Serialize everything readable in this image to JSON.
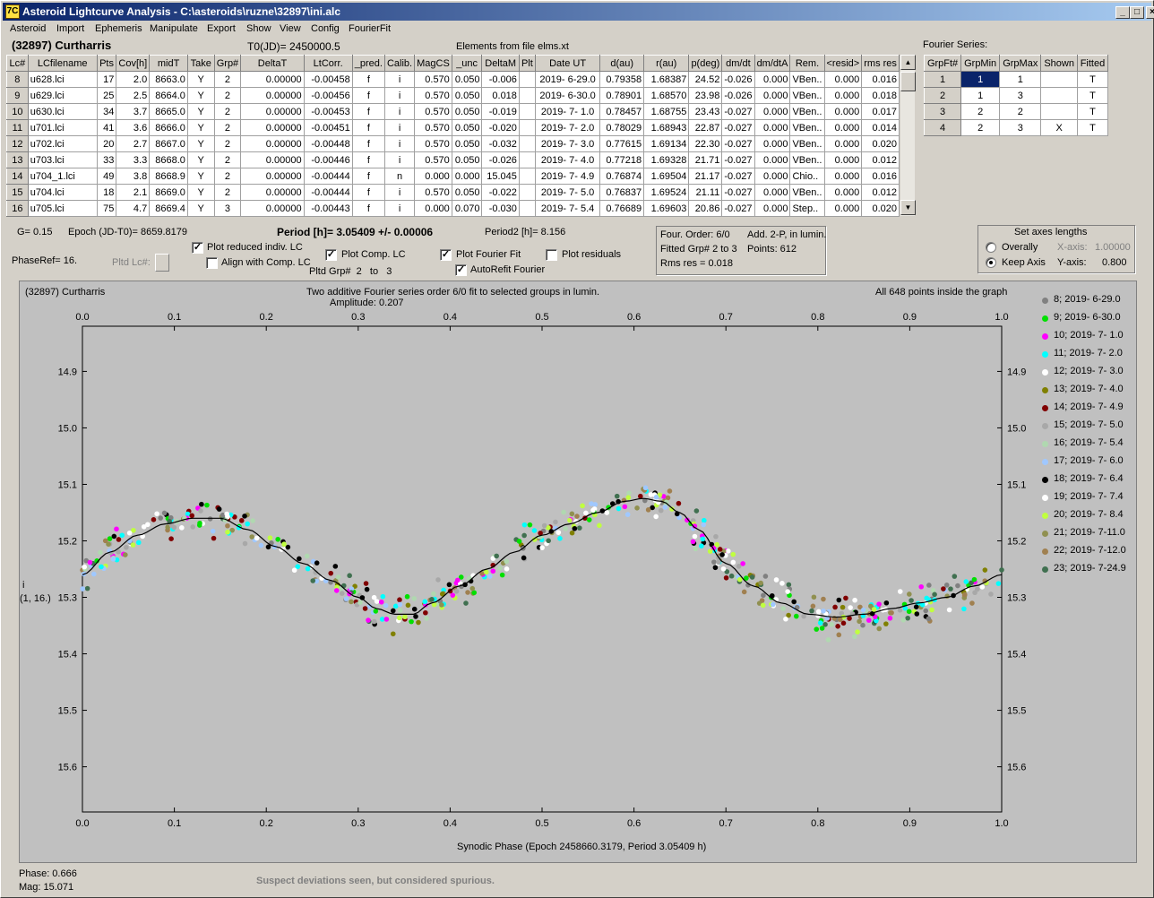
{
  "window": {
    "title": "Asteroid Lightcurve Analysis - C:\\asteroids\\ruzne\\32897\\ini.alc",
    "icon": "7C",
    "min": "_",
    "max": "□",
    "close": "×"
  },
  "menu": [
    "Asteroid",
    "Import",
    "Ephemeris",
    "Manipulate",
    "Export",
    "Show",
    "View",
    "Config",
    "FourierFit"
  ],
  "header": {
    "asteroid": "(32897) Curtharris",
    "t0": "T0(JD)= 2450000.5",
    "elements": "Elements from file elms.xt"
  },
  "table": {
    "columns": [
      "Lc#",
      "LCfilename",
      "Pts",
      "Cov[h]",
      "midT",
      "Take",
      "Grp#",
      "DeltaT",
      "LtCorr.",
      "_pred.",
      "Calib.",
      "MagCS",
      "_unc",
      "DeltaM",
      "Plt",
      "Date UT",
      "d(au)",
      "r(au)",
      "p(deg)",
      "dm/dt",
      "dm/dtA",
      "Rem.",
      "<resid>",
      "rms res"
    ],
    "rows": [
      [
        "8",
        "u628.lci",
        "17",
        "2.0",
        "8663.0",
        "Y",
        "2",
        "0.00000",
        "-0.00458",
        "f",
        "i",
        "0.570",
        "0.050",
        "-0.006",
        "",
        "2019- 6-29.0",
        "0.79358",
        "1.68387",
        "24.52",
        "-0.026",
        "0.000",
        "VBen..",
        "0.000",
        "0.016"
      ],
      [
        "9",
        "u629.lci",
        "25",
        "2.5",
        "8664.0",
        "Y",
        "2",
        "0.00000",
        "-0.00456",
        "f",
        "i",
        "0.570",
        "0.050",
        "0.018",
        "",
        "2019- 6-30.0",
        "0.78901",
        "1.68570",
        "23.98",
        "-0.026",
        "0.000",
        "VBen..",
        "0.000",
        "0.018"
      ],
      [
        "10",
        "u630.lci",
        "34",
        "3.7",
        "8665.0",
        "Y",
        "2",
        "0.00000",
        "-0.00453",
        "f",
        "i",
        "0.570",
        "0.050",
        "-0.019",
        "",
        "2019- 7- 1.0",
        "0.78457",
        "1.68755",
        "23.43",
        "-0.027",
        "0.000",
        "VBen..",
        "0.000",
        "0.017"
      ],
      [
        "11",
        "u701.lci",
        "41",
        "3.6",
        "8666.0",
        "Y",
        "2",
        "0.00000",
        "-0.00451",
        "f",
        "i",
        "0.570",
        "0.050",
        "-0.020",
        "",
        "2019- 7- 2.0",
        "0.78029",
        "1.68943",
        "22.87",
        "-0.027",
        "0.000",
        "VBen..",
        "0.000",
        "0.014"
      ],
      [
        "12",
        "u702.lci",
        "20",
        "2.7",
        "8667.0",
        "Y",
        "2",
        "0.00000",
        "-0.00448",
        "f",
        "i",
        "0.570",
        "0.050",
        "-0.032",
        "",
        "2019- 7- 3.0",
        "0.77615",
        "1.69134",
        "22.30",
        "-0.027",
        "0.000",
        "VBen..",
        "0.000",
        "0.020"
      ],
      [
        "13",
        "u703.lci",
        "33",
        "3.3",
        "8668.0",
        "Y",
        "2",
        "0.00000",
        "-0.00446",
        "f",
        "i",
        "0.570",
        "0.050",
        "-0.026",
        "",
        "2019- 7- 4.0",
        "0.77218",
        "1.69328",
        "21.71",
        "-0.027",
        "0.000",
        "VBen..",
        "0.000",
        "0.012"
      ],
      [
        "14",
        "u704_1.lci",
        "49",
        "3.8",
        "8668.9",
        "Y",
        "2",
        "0.00000",
        "-0.00444",
        "f",
        "n",
        "0.000",
        "0.000",
        "15.045",
        "",
        "2019- 7- 4.9",
        "0.76874",
        "1.69504",
        "21.17",
        "-0.027",
        "0.000",
        "Chio..",
        "0.000",
        "0.016"
      ],
      [
        "15",
        "u704.lci",
        "18",
        "2.1",
        "8669.0",
        "Y",
        "2",
        "0.00000",
        "-0.00444",
        "f",
        "i",
        "0.570",
        "0.050",
        "-0.022",
        "",
        "2019- 7- 5.0",
        "0.76837",
        "1.69524",
        "21.11",
        "-0.027",
        "0.000",
        "VBen..",
        "0.000",
        "0.012"
      ],
      [
        "16",
        "u705.lci",
        "75",
        "4.7",
        "8669.4",
        "Y",
        "3",
        "0.00000",
        "-0.00443",
        "f",
        "i",
        "0.000",
        "0.070",
        "-0.030",
        "",
        "2019- 7- 5.4",
        "0.76689",
        "1.69603",
        "20.86",
        "-0.027",
        "0.000",
        "Step..",
        "0.000",
        "0.020"
      ]
    ]
  },
  "fourier_table": {
    "label": "Fourier Series:",
    "columns": [
      "GrpFt#",
      "GrpMin",
      "GrpMax",
      "Shown",
      "Fitted"
    ],
    "rows": [
      [
        "1",
        "1",
        "1",
        "",
        "T"
      ],
      [
        "2",
        "1",
        "3",
        "",
        "T"
      ],
      [
        "3",
        "2",
        "2",
        "",
        "T"
      ],
      [
        "4",
        "2",
        "3",
        "X",
        "T"
      ]
    ]
  },
  "params": {
    "g": "G= 0.15",
    "epoch": "Epoch (JD-T0)= 8659.8179",
    "period": "Period [h]= 3.05409 +/- 0.00006",
    "period2": "Period2 [h]= 8.156",
    "phaseref": "PhaseRef= 16.",
    "pltd_lc": "Pltd Lc#:",
    "pltd_grp_label": "Pltd Grp#",
    "pltd_grp_from": "2",
    "pltd_grp_to_label": "to",
    "pltd_grp_to": "3"
  },
  "checks": {
    "plot_reduced": {
      "label": "Plot reduced indiv. LC",
      "on": true
    },
    "align_comp": {
      "label": "Align with Comp. LC",
      "on": false
    },
    "plot_comp": {
      "label": "Plot Comp. LC",
      "on": true
    },
    "plot_fourier": {
      "label": "Plot Fourier Fit",
      "on": true
    },
    "plot_resid": {
      "label": "Plot residuals",
      "on": false
    },
    "autorefit": {
      "label": "AutoRefit Fourier",
      "on": true
    }
  },
  "fit_info": {
    "order": "Four. Order:  6/0",
    "add": "Add. 2-P, in lumin.",
    "fitted": "Fitted Grp# 2 to 3",
    "points": "Points: 612",
    "rms": "Rms res     = 0.018"
  },
  "axes": {
    "title": "Set axes lengths",
    "overally": "Overally",
    "keep": "Keep Axis",
    "xlabel": "X-axis:",
    "xval": "1.00000",
    "ylabel": "Y-axis:",
    "yval": "0.800"
  },
  "plot": {
    "name": "(32897) Curtharris",
    "fit_title": "Two additive Fourier series order 6/0 fit to selected groups in lumin.",
    "amplitude": "Amplitude: 0.207",
    "inside": "All 648 points inside the graph",
    "xlabel": "Synodic Phase (Epoch 2458660.3179, Period 3.05409 h)",
    "ylabel1": "i",
    "ylabel2": "(1, 16.)"
  },
  "chart_data": {
    "type": "scatter",
    "xlim": [
      0,
      1
    ],
    "ylim": [
      15.68,
      14.82
    ],
    "xticks": [
      "0.0",
      "0.1",
      "0.2",
      "0.3",
      "0.4",
      "0.5",
      "0.6",
      "0.7",
      "0.8",
      "0.9",
      "1.0"
    ],
    "yticks": [
      "14.9",
      "15.0",
      "15.1",
      "15.2",
      "15.3",
      "15.4",
      "15.5",
      "15.6"
    ],
    "fit_curve": {
      "x": [
        0.0,
        0.03,
        0.06,
        0.09,
        0.12,
        0.15,
        0.18,
        0.21,
        0.24,
        0.27,
        0.3,
        0.32,
        0.34,
        0.36,
        0.38,
        0.41,
        0.44,
        0.47,
        0.5,
        0.53,
        0.56,
        0.59,
        0.61,
        0.63,
        0.65,
        0.67,
        0.7,
        0.73,
        0.76,
        0.79,
        0.82,
        0.85,
        0.88,
        0.91,
        0.94,
        0.97,
        1.0
      ],
      "y": [
        15.26,
        15.22,
        15.19,
        15.17,
        15.16,
        15.16,
        15.18,
        15.21,
        15.24,
        15.27,
        15.3,
        15.32,
        15.33,
        15.33,
        15.31,
        15.28,
        15.25,
        15.22,
        15.19,
        15.17,
        15.15,
        15.13,
        15.125,
        15.13,
        15.15,
        15.18,
        15.24,
        15.28,
        15.31,
        15.33,
        15.335,
        15.33,
        15.32,
        15.31,
        15.3,
        15.28,
        15.26
      ]
    },
    "legend": [
      {
        "label": "8; 2019- 6-29.0",
        "color": "#808080"
      },
      {
        "label": "9; 2019- 6-30.0",
        "color": "#00e000"
      },
      {
        "label": "10; 2019- 7- 1.0",
        "color": "#ff00ff"
      },
      {
        "label": "11; 2019- 7- 2.0",
        "color": "#00ffff"
      },
      {
        "label": "12; 2019- 7- 3.0",
        "color": "#ffffff"
      },
      {
        "label": "13; 2019- 7- 4.0",
        "color": "#808000"
      },
      {
        "label": "14; 2019- 7- 4.9",
        "color": "#800000"
      },
      {
        "label": "15; 2019- 7- 5.0",
        "color": "#a8a8a8"
      },
      {
        "label": "16; 2019- 7- 5.4",
        "color": "#b0d8b0"
      },
      {
        "label": "17; 2019- 7- 6.0",
        "color": "#a0c8ff"
      },
      {
        "label": "18; 2019- 7- 6.4",
        "color": "#000000"
      },
      {
        "label": "19; 2019- 7- 7.4",
        "color": "#ffffff"
      },
      {
        "label": "20; 2019- 7- 8.4",
        "color": "#c0ff40"
      },
      {
        "label": "21; 2019- 7-11.0",
        "color": "#909050"
      },
      {
        "label": "22; 2019- 7-12.0",
        "color": "#a08050"
      },
      {
        "label": "23; 2019- 7-24.9",
        "color": "#407050"
      }
    ]
  },
  "status": {
    "phase": "Phase:  0.666",
    "mag": "Mag:    15.071",
    "note": "Suspect deviations seen, but considered spurious."
  }
}
